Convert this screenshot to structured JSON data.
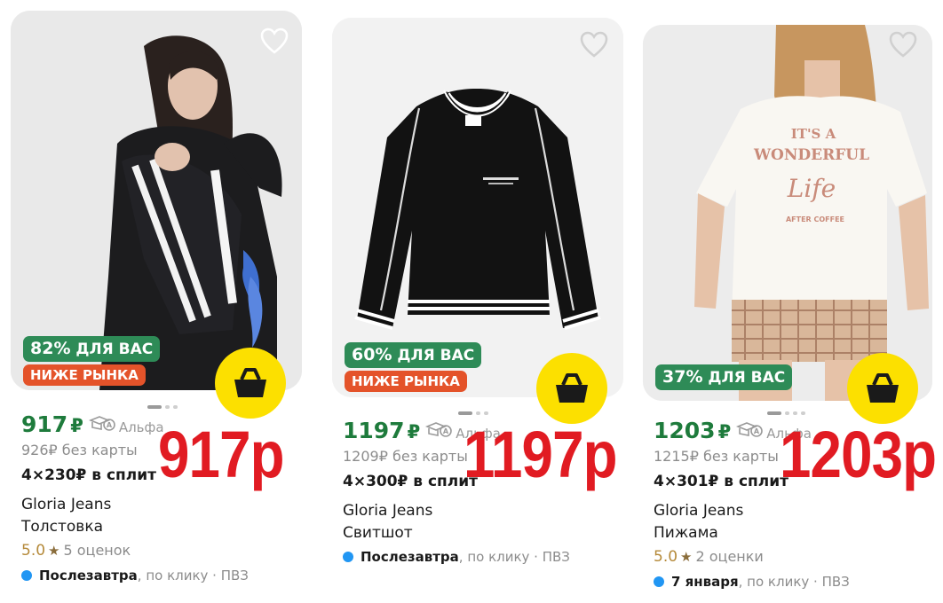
{
  "products": [
    {
      "discount_pct": "82%",
      "discount_label": "ДЛЯ ВАС",
      "market_badge": "НИЖЕ РЫНКА",
      "price": "917",
      "currency": "₽",
      "bank": "Альфа",
      "old_price": "926₽ без карты",
      "split": "4×230₽ в сплит",
      "brand": "Gloria Jeans",
      "title": "Толстовка",
      "rating_score": "5.0",
      "rating_count": "5 оценок",
      "delivery_day": "Послезавтра",
      "delivery_rest": ", по клику · ПВЗ",
      "overlay_price": "917р"
    },
    {
      "discount_pct": "60%",
      "discount_label": "ДЛЯ ВАС",
      "market_badge": "НИЖЕ РЫНКА",
      "price": "1197",
      "currency": "₽",
      "bank": "Альфа",
      "old_price": "1209₽ без карты",
      "split": "4×300₽ в сплит",
      "brand": "Gloria Jeans",
      "title": "Свитшот",
      "delivery_day": "Послезавтра",
      "delivery_rest": ", по клику · ПВЗ",
      "overlay_price": "1197р"
    },
    {
      "discount_pct": "37%",
      "discount_label": "ДЛЯ ВАС",
      "price": "1203",
      "currency": "₽",
      "bank": "Альфа",
      "old_price": "1215₽ без карты",
      "split": "4×301₽ в сплит",
      "brand": "Gloria Jeans",
      "title": "Пижама",
      "rating_score": "5.0",
      "rating_count": "2 оценки",
      "delivery_day": "7 января",
      "delivery_rest": ", по клику · ПВЗ",
      "overlay_price": "1203р",
      "shirt_print": [
        "IT'S A",
        "WONDERFUL",
        "Life",
        "AFTER COFFEE"
      ]
    }
  ],
  "colors": {
    "price_green": "#1e7b3c",
    "discount_badge": "#2e8b57",
    "market_badge": "#e4532a",
    "cart_button": "#fce000",
    "overlay_red": "#e11b22",
    "delivery_dot": "#2196f3"
  },
  "icons": {
    "favorite": "heart-icon",
    "cart": "basket-icon",
    "bank": "alfa-bank-icon",
    "rating": "star-icon"
  }
}
